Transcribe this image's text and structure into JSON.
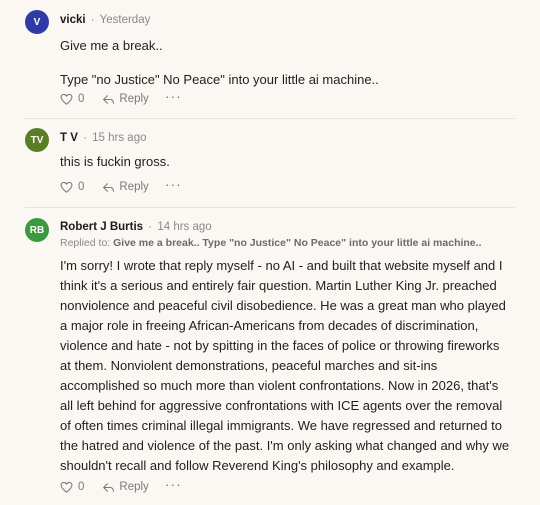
{
  "comments": [
    {
      "initials": "V",
      "avatar_color": "#2e3aa7",
      "author": "vicki",
      "separator": "·",
      "time": "Yesterday",
      "paragraphs": [
        "Give me a break..",
        "Type \"no Justice\" No Peace\" into your little ai machine.."
      ],
      "likes": "0",
      "reply_label": "Reply",
      "more_label": "···"
    },
    {
      "initials": "TV",
      "avatar_color": "#5a7d26",
      "author": "T V",
      "separator": "·",
      "time": "15 hrs ago",
      "paragraphs": [
        "this is fuckin gross."
      ],
      "likes": "0",
      "reply_label": "Reply",
      "more_label": "···"
    },
    {
      "initials": "RB",
      "avatar_color": "#3c9a3e",
      "author": "Robert J Burtis",
      "separator": "·",
      "time": "14 hrs ago",
      "replied_prefix": "Replied to: ",
      "replied_text": "Give me a break.. Type \"no Justice\" No Peace\" into your little ai machine..",
      "paragraphs": [
        "I'm sorry! I wrote that reply myself - no AI - and built that website myself and I think it's a serious and entirely fair question. Martin Luther King Jr. preached nonviolence and peaceful civil disobedience. He was a great man who played a major role in freeing African-Americans from decades of discrimination, violence and hate - not by spitting in the faces of police or throwing fireworks at them. Nonviolent demonstrations, peaceful marches and sit-ins accomplished so much more than violent confrontations. Now in 2026, that's all left behind for aggressive confrontations with ICE agents over the removal of often times criminal illegal immigrants. We have regressed and returned to the hatred and violence of the past. I'm only asking what changed and why we shouldn't recall and follow Reverend King's philosophy and example."
      ],
      "likes": "0",
      "reply_label": "Reply",
      "more_label": "···"
    }
  ],
  "icons": {
    "like": "heart-icon",
    "reply": "reply-arrow-icon",
    "more": "more-options-icon"
  }
}
